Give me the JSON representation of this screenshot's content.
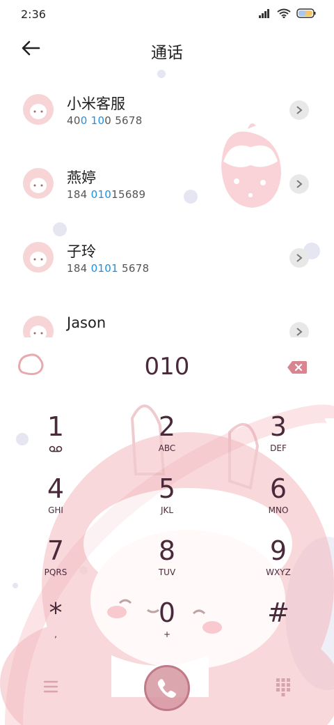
{
  "status_bar": {
    "time": "2:36"
  },
  "header": {
    "title": "通话",
    "back_icon": "arrow-left-icon"
  },
  "contacts": [
    {
      "name": "小米客服",
      "number_parts": [
        "40",
        "0",
        " ",
        "10",
        "0 5678"
      ],
      "highlight_color": "#1f8fe0"
    },
    {
      "name": "燕婷",
      "number_parts": [
        "184 ",
        "010",
        "15689"
      ],
      "highlight_color": "#1f8fe0"
    },
    {
      "name": "子玲",
      "number_parts": [
        "184 ",
        "0101",
        " 5678"
      ],
      "highlight_color": "#1f8fe0"
    },
    {
      "name": "Jason",
      "number_parts": [
        ""
      ],
      "highlight_color": "#1f8fe0"
    }
  ],
  "dialer": {
    "value": "010",
    "delete_icon": "backspace-icon"
  },
  "keys": [
    {
      "digit": "1",
      "letters": "",
      "icon": "voicemail-icon"
    },
    {
      "digit": "2",
      "letters": "ABC"
    },
    {
      "digit": "3",
      "letters": "DEF"
    },
    {
      "digit": "4",
      "letters": "GHI"
    },
    {
      "digit": "5",
      "letters": "JKL"
    },
    {
      "digit": "6",
      "letters": "MNO"
    },
    {
      "digit": "7",
      "letters": "PQRS"
    },
    {
      "digit": "8",
      "letters": "TUV"
    },
    {
      "digit": "9",
      "letters": "WXYZ"
    },
    {
      "digit": "*",
      "letters": ","
    },
    {
      "digit": "0",
      "letters": "+"
    },
    {
      "digit": "#",
      "letters": ""
    }
  ],
  "bottom_bar": {
    "menu_icon": "menu-icon",
    "call_icon": "phone-icon",
    "keypad_icon": "dialpad-icon"
  },
  "colors": {
    "accent_text": "#4a2a3a",
    "highlight": "#1f8fe0",
    "call_button": "#d696a0",
    "delete": "#d9858f"
  }
}
